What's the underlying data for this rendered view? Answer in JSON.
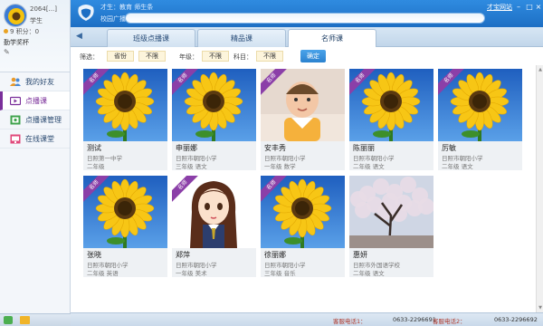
{
  "colors": {
    "accent": "#7a2f9a",
    "topbar": "#2f8be0",
    "button": "#2b82cf"
  },
  "profile": {
    "uid": "2064[...]",
    "role": "学生",
    "stats": "9   积分：0",
    "name": "勤学奖杯"
  },
  "nav": [
    {
      "label": "我的好友",
      "icon": "friends-icon"
    },
    {
      "label": "点播课",
      "icon": "video-icon"
    },
    {
      "label": "点播课管理",
      "icon": "manage-icon"
    },
    {
      "label": "在线课堂",
      "icon": "classroom-icon"
    }
  ],
  "topbar": {
    "site_text": "才生：教育  师生条",
    "breadcrumb_label": "校园广播：",
    "right_link": "才宝网站"
  },
  "tabs": [
    "班级点播课",
    "精品课",
    "名师课"
  ],
  "filter": {
    "label": "筛选：",
    "year_value": "省份",
    "unlimited": "不限",
    "grade_label": "年级：",
    "subject_label": "科目：",
    "confirm": "确定"
  },
  "ribbon": "名师",
  "teachers": [
    {
      "name": "测试",
      "school": "日照第一中学",
      "grade": "二年级",
      "img": "sunflower",
      "ribbon": true
    },
    {
      "name": "申丽娜",
      "school": "日照市朝阳小学",
      "grade": "三年级 语文",
      "img": "sunflower",
      "ribbon": true
    },
    {
      "name": "安丰秀",
      "school": "日照市朝阳小学",
      "grade": "一年级 数学",
      "img": "baby",
      "ribbon": true
    },
    {
      "name": "陈丽丽",
      "school": "日照市朝阳小学",
      "grade": "二年级 语文",
      "img": "sunflower",
      "ribbon": true
    },
    {
      "name": "厉敏",
      "school": "日照市朝阳小学",
      "grade": "二年级 语文",
      "img": "sunflower",
      "ribbon": true
    },
    {
      "name": "张晓",
      "school": "日照市朝阳小学",
      "grade": "二年级 英语",
      "img": "sunflower",
      "ribbon": true
    },
    {
      "name": "郑萍",
      "school": "日照市朝阳小学",
      "grade": "一年级 美术",
      "img": "girl",
      "ribbon": true
    },
    {
      "name": "徐丽娜",
      "school": "日照市朝阳小学",
      "grade": "三年级 音乐",
      "img": "sunflower",
      "ribbon": true
    },
    {
      "name": "惠妍",
      "school": "日照市外国语学校",
      "grade": "二年级 语文",
      "img": "tree",
      "ribbon": false
    }
  ],
  "status": {
    "hotline1_label": "客服电话1：",
    "hotline1": "0633-2296691",
    "hotline2_label": "客服电话2：",
    "hotline2": "0633-2296692",
    "hours": "客服时间"
  }
}
